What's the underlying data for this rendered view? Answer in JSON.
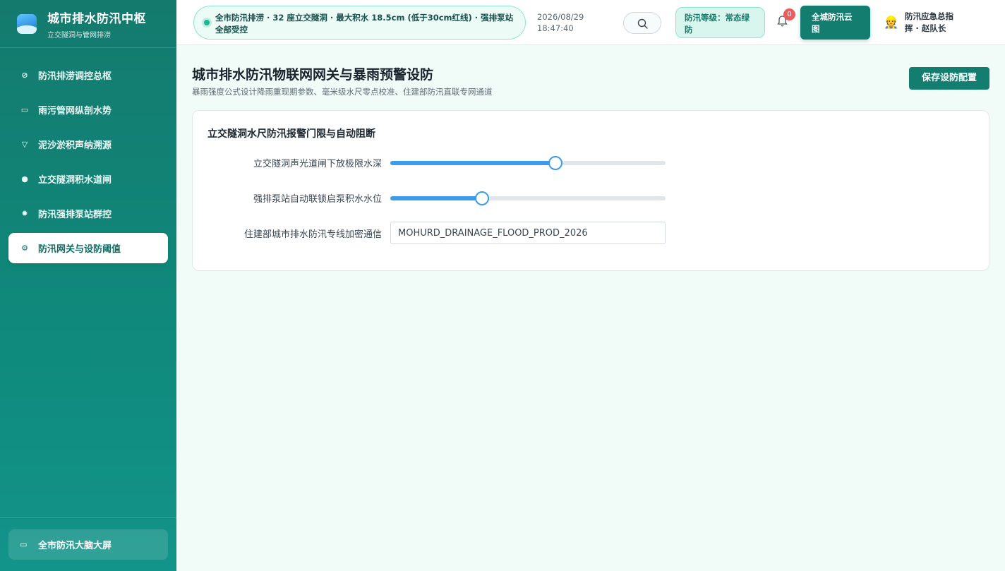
{
  "app": {
    "title": "城市排水防汛中枢",
    "subtitle": "立交隧洞与管网排涝"
  },
  "sidebar": {
    "items": [
      {
        "label": "防汛排涝调控总枢",
        "icon": "compass-icon",
        "glyph": "⊘"
      },
      {
        "label": "雨污管网纵剖水势",
        "icon": "monitor-icon",
        "glyph": "▭"
      },
      {
        "label": "泥沙淤积声纳溯源",
        "icon": "filter-icon",
        "glyph": "▽"
      },
      {
        "label": "立交隧洞积水道闸",
        "icon": "alert-icon",
        "glyph": "●"
      },
      {
        "label": "防汛强排泵站群控",
        "icon": "sun-icon",
        "glyph": "✹"
      },
      {
        "label": "防汛网关与设防阈值",
        "icon": "gear-icon",
        "glyph": "⚙",
        "active": true
      }
    ],
    "bottom_button": {
      "label": "全市防汛大脑大屏",
      "icon": "screen-icon",
      "glyph": "▭"
    }
  },
  "topbar": {
    "status": "全市防汛排涝 · 32 座立交隧洞 · 最大积水 18.5cm (低于30cm红线) · 强排泵站全部受控",
    "date": "2026/08/29",
    "time": "18:47:40",
    "level": "防汛等级：常态绿防",
    "notification_count": "0",
    "cloud_button": "全城防汛云图",
    "user": "防汛应急总指挥 · 赵队长"
  },
  "page": {
    "title": "城市排水防汛物联网网关与暴雨预警设防",
    "subtitle": "暴雨强度公式设计降雨重现期参数、毫米级水尺零点校准、住建部防汛直联专网通道",
    "save_button": "保存设防配置"
  },
  "card": {
    "title": "立交隧洞水尺防汛报警门限与自动阻断",
    "fields": [
      {
        "label": "立交隧洞声光道闸下放极限水深",
        "type": "slider",
        "value_fraction": 0.6
      },
      {
        "label": "强排泵站自动联锁启泵积水水位",
        "type": "slider",
        "value_fraction": 0.333
      },
      {
        "label": "住建部城市排水防汛专线加密通信",
        "type": "text",
        "value": "MOHURD_DRAINAGE_FLOOD_PROD_2026"
      }
    ]
  },
  "colors": {
    "primary": "#137d70",
    "accent_blue": "#3d9be9",
    "alert_red": "#ef5b5b"
  }
}
